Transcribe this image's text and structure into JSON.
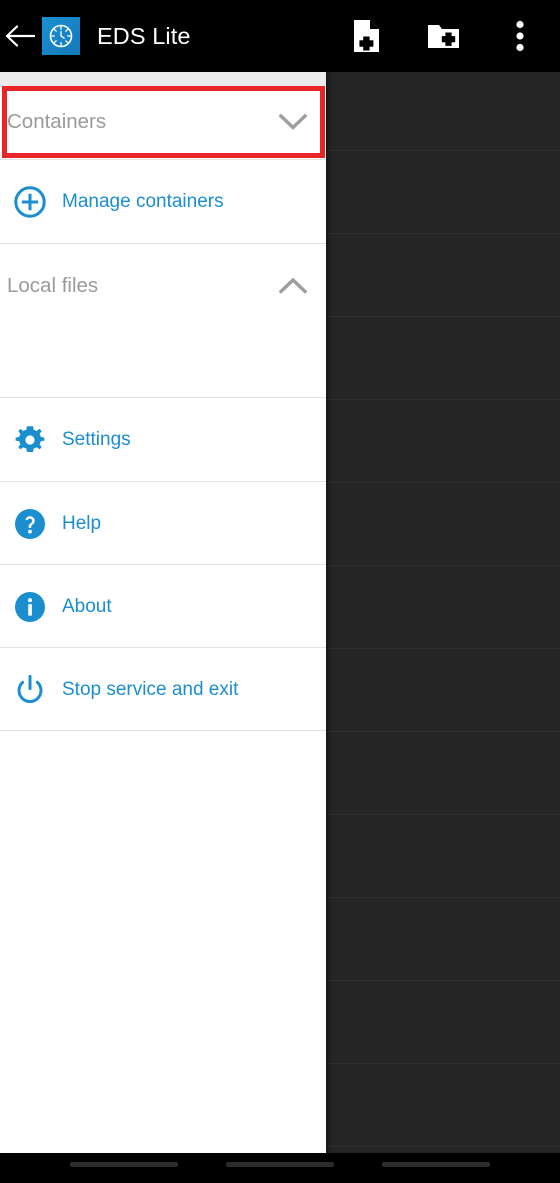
{
  "appbar": {
    "back_icon": "back-arrow-icon",
    "app_icon": "eds-clock-icon",
    "title": "EDS Lite",
    "actions": [
      {
        "name": "new-file",
        "icon": "file-plus-icon",
        "label": "New file"
      },
      {
        "name": "new-folder",
        "icon": "folder-plus-icon",
        "label": "New folder"
      },
      {
        "name": "overflow",
        "icon": "more-vertical-icon",
        "label": "More options"
      }
    ]
  },
  "drawer": {
    "sections": [
      {
        "name": "containers",
        "label": "Containers",
        "chevron": "chevron-down-icon",
        "expanded": false,
        "highlighted": true
      },
      {
        "name": "local-files",
        "label": "Local files",
        "chevron": "chevron-up-icon",
        "expanded": true,
        "highlighted": false
      }
    ],
    "items": [
      {
        "name": "manage-containers",
        "label": "Manage containers",
        "icon": "plus-circle-outline-icon"
      },
      {
        "name": "settings",
        "label": "Settings",
        "icon": "gear-icon"
      },
      {
        "name": "help",
        "label": "Help",
        "icon": "question-circle-icon"
      },
      {
        "name": "about",
        "label": "About",
        "icon": "info-circle-icon"
      },
      {
        "name": "stop-service-and-exit",
        "label": "Stop service and exit",
        "icon": "power-icon"
      }
    ]
  },
  "navbar": {
    "pills": [
      "recents-pill",
      "home-pill",
      "back-pill"
    ]
  },
  "colors": {
    "accent": "#1a8ecf",
    "highlight": "#e8262a",
    "section_text": "#9a9a9a",
    "appbar_bg": "#000000",
    "drawer_bg": "#ffffff",
    "scrim_bg": "#252525",
    "divider": "#e2e2e2"
  }
}
